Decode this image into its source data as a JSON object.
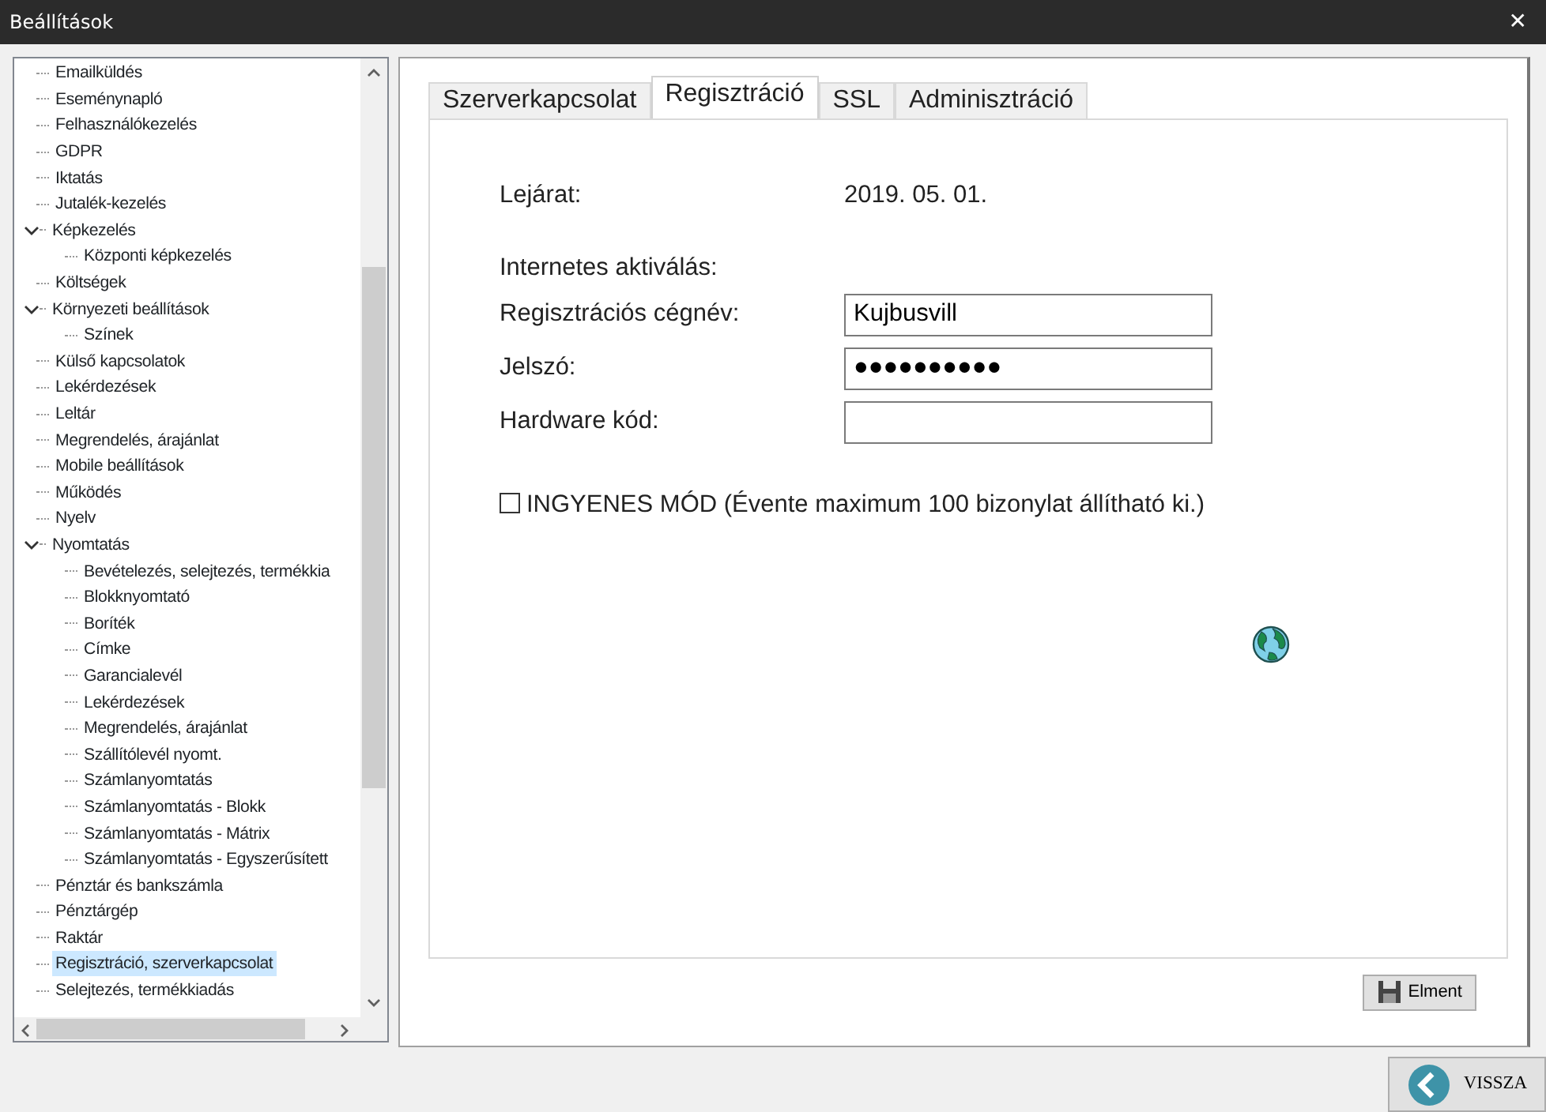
{
  "window": {
    "title": "Beállítások",
    "close": "✕"
  },
  "tree": {
    "items": [
      {
        "label": "Emailküldés",
        "selected": false
      },
      {
        "label": "Eseménynapló",
        "selected": false
      },
      {
        "label": "Felhasználókezelés",
        "selected": false
      },
      {
        "label": "GDPR",
        "selected": false
      },
      {
        "label": "Iktatás",
        "selected": false
      },
      {
        "label": "Jutalék-kezelés",
        "selected": false
      },
      {
        "label": "Képkezelés",
        "selected": false,
        "expanded": true,
        "children": [
          {
            "label": "Központi képkezelés",
            "selected": false
          }
        ]
      },
      {
        "label": "Költségek",
        "selected": false
      },
      {
        "label": "Környezeti beállítások",
        "selected": false,
        "expanded": true,
        "children": [
          {
            "label": "Színek",
            "selected": false
          }
        ]
      },
      {
        "label": "Külső kapcsolatok",
        "selected": false
      },
      {
        "label": "Lekérdezések",
        "selected": false
      },
      {
        "label": "Leltár",
        "selected": false
      },
      {
        "label": "Megrendelés, árajánlat",
        "selected": false
      },
      {
        "label": "Mobile beállítások",
        "selected": false
      },
      {
        "label": "Működés",
        "selected": false
      },
      {
        "label": "Nyelv",
        "selected": false
      },
      {
        "label": "Nyomtatás",
        "selected": false,
        "expanded": true,
        "children": [
          {
            "label": "Bevételezés, selejtezés, termékkia",
            "selected": false
          },
          {
            "label": "Blokknyomtató",
            "selected": false
          },
          {
            "label": "Boríték",
            "selected": false
          },
          {
            "label": "Címke",
            "selected": false
          },
          {
            "label": "Garancialevél",
            "selected": false
          },
          {
            "label": "Lekérdezések",
            "selected": false
          },
          {
            "label": "Megrendelés, árajánlat",
            "selected": false
          },
          {
            "label": "Szállítólevél nyomt.",
            "selected": false
          },
          {
            "label": "Számlanyomtatás",
            "selected": false
          },
          {
            "label": "Számlanyomtatás - Blokk",
            "selected": false
          },
          {
            "label": "Számlanyomtatás - Mátrix",
            "selected": false
          },
          {
            "label": "Számlanyomtatás - Egyszerűsített",
            "selected": false
          }
        ]
      },
      {
        "label": "Pénztár és bankszámla",
        "selected": false
      },
      {
        "label": "Pénztárgép",
        "selected": false
      },
      {
        "label": "Raktár",
        "selected": false
      },
      {
        "label": "Regisztráció, szerverkapcsolat",
        "selected": true
      },
      {
        "label": "Selejtezés, termékkiadás",
        "selected": false
      }
    ]
  },
  "tabs": [
    {
      "label": "Szerverkapcsolat",
      "selected": false
    },
    {
      "label": "Regisztráció",
      "selected": true
    },
    {
      "label": "SSL",
      "selected": false
    },
    {
      "label": "Adminisztráció",
      "selected": false
    }
  ],
  "form": {
    "expiry_label": "Lejárat:",
    "expiry_value": "2019. 05. 01.",
    "section_label": "Internetes aktiválás:",
    "fields": [
      {
        "label": "Regisztrációs cégnév:",
        "value": "Kujbusvill"
      },
      {
        "label": "Jelszó:",
        "value": "●●●●●●●●●●"
      },
      {
        "label": "Hardware kód:"
      }
    ],
    "checkbox": {
      "label": "INGYENES MÓD (Évente maximum 100 bizonylat állítható ki.)",
      "checked": false
    }
  },
  "save_button": "Elment",
  "back_button": "VISSZA"
}
